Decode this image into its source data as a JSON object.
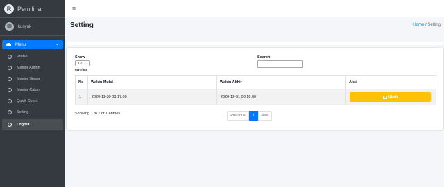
{
  "sidebar": {
    "brand": {
      "logo_letter": "R",
      "title": "Pemilihan"
    },
    "user": {
      "name": "kunyuk"
    },
    "menu": {
      "label": "Menu",
      "chevron": "⌄"
    },
    "items": [
      {
        "label": "Profile"
      },
      {
        "label": "Master Admin"
      },
      {
        "label": "Master Siswa"
      },
      {
        "label": "Master Calon"
      },
      {
        "label": "Quick Count"
      },
      {
        "label": "Setting"
      },
      {
        "label": "Logout"
      }
    ]
  },
  "navbar": {
    "toggle_icon": "≡"
  },
  "header": {
    "title": "Setting",
    "breadcrumb": {
      "home": "Home",
      "separator": "/",
      "current": "Setting"
    }
  },
  "datatable": {
    "show_label": "Show",
    "length_value": "10",
    "entries_label": "entries",
    "search_label": "Search:",
    "search_value": "",
    "columns": [
      "No",
      "Waktu Mulai",
      "Waktu Akhir",
      "Aksi"
    ],
    "rows": [
      {
        "no": "1",
        "start": "2020-11-30 03:17:00",
        "end": "2020-12-31 03:18:00",
        "action": "Ubah"
      }
    ],
    "info": "Showing 1 to 1 of 1 entries",
    "pagination": {
      "previous": "Previous",
      "current": "1",
      "next": "Next"
    }
  },
  "colors": {
    "accent": "#007bff",
    "warning": "#ffc107",
    "sidebar": "#343a40"
  },
  "icons": {
    "edit": "edit-icon",
    "circle": "circle-icon",
    "menu": "dashboard-icon"
  }
}
